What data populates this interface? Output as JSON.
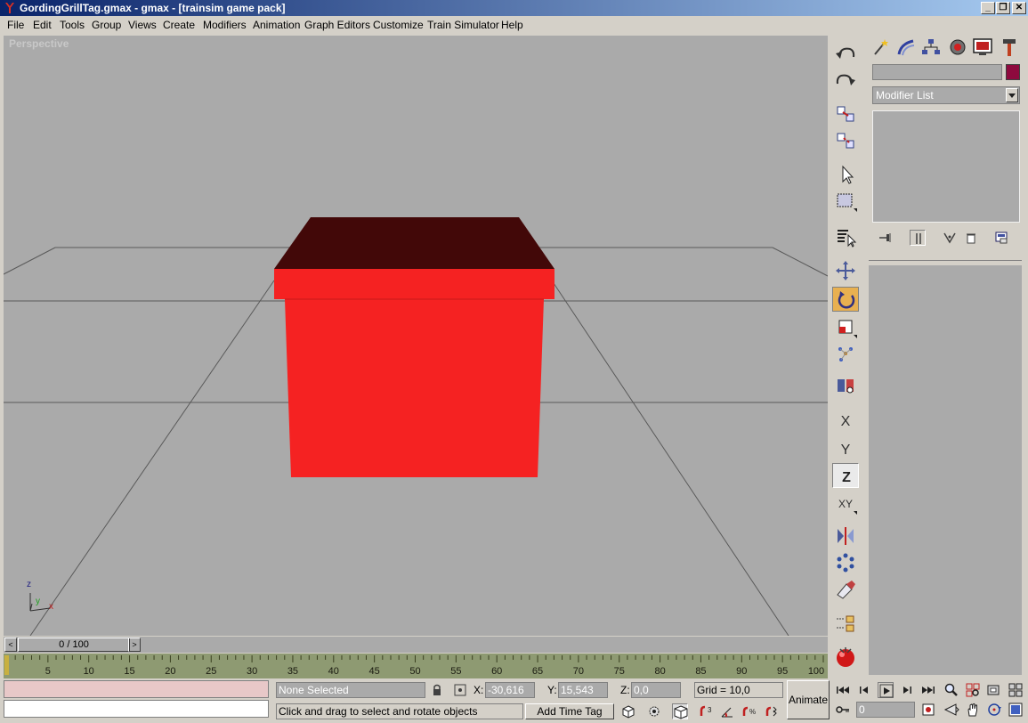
{
  "window": {
    "title": "GordingGrillTag.gmax - gmax - [trainsim game pack]",
    "min_label": "_",
    "restore_label": "❐",
    "close_label": "✕"
  },
  "menu": [
    "File",
    "Edit",
    "Tools",
    "Group",
    "Views",
    "Create",
    "Modifiers",
    "Animation",
    "Graph Editors",
    "Customize",
    "Train Simulator",
    "Help"
  ],
  "viewport": {
    "label": "Perspective",
    "axis_z": "z",
    "axis_y": "y",
    "axis_x": "x",
    "object_colors": {
      "top": "#420808",
      "front": "#f52222",
      "side": "#d61e1e"
    }
  },
  "time_slider": {
    "label": "0 / 100",
    "prev": "<",
    "next": ">"
  },
  "trackbar": {
    "ticks": [
      "5",
      "10",
      "15",
      "20",
      "25",
      "30",
      "35",
      "40",
      "45",
      "50",
      "55",
      "60",
      "65",
      "70",
      "75",
      "80",
      "85",
      "90",
      "95",
      "100"
    ]
  },
  "command_panel": {
    "modifier_list": "Modifier List",
    "color": "#8e0a3e",
    "stack_buttons": [
      "pin-stack-icon",
      "show-end-result-icon",
      "make-unique-icon",
      "remove-modifier-icon",
      "configure-modifier-sets-icon"
    ]
  },
  "main_toolbar": [
    "undo-icon",
    "redo-icon",
    "select-and-link-icon",
    "unlink-selection-icon",
    "select-object-icon",
    "rectangular-selection-icon",
    "select-by-name-icon",
    "select-and-move-icon",
    "select-and-rotate-icon",
    "select-and-scale-icon",
    "use-pivot-center-icon",
    "named-selection-icon",
    "restrict-x-icon",
    "restrict-y-icon",
    "restrict-z-icon",
    "restrict-xy-icon",
    "mirror-icon",
    "array-icon",
    "align-icon",
    "spacing-tool-icon",
    "render-icon"
  ],
  "constraints": {
    "x": "X",
    "y": "Y",
    "z": "Z",
    "xy": "XY"
  },
  "status": {
    "selection": "None Selected",
    "x_label": "X:",
    "x_value": "-30,616",
    "y_label": "Y:",
    "y_value": "15,543",
    "z_label": "Z:",
    "z_value": "0,0",
    "grid": "Grid = 10,0",
    "prompt": "Click and drag to select and rotate objects",
    "add_time_tag": "Add Time Tag",
    "animate": "Animate",
    "frame": "0"
  }
}
